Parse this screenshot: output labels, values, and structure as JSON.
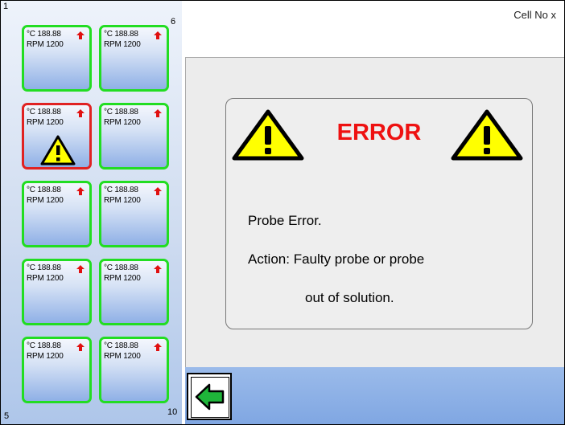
{
  "header": {
    "cell_no": "Cell No  x"
  },
  "corners": {
    "top_left": "1",
    "top_right": "6",
    "bottom_left": "5",
    "bottom_right": "10"
  },
  "cells": [
    {
      "temp": "°C 188.88",
      "rpm": "RPM 1200",
      "status": "ok",
      "warning": false
    },
    {
      "temp": "°C 188.88",
      "rpm": "RPM 1200",
      "status": "ok",
      "warning": false
    },
    {
      "temp": "°C 188.88",
      "rpm": "RPM 1200",
      "status": "error",
      "warning": true
    },
    {
      "temp": "°C 188.88",
      "rpm": "RPM 1200",
      "status": "ok",
      "warning": false
    },
    {
      "temp": "°C 188.88",
      "rpm": "RPM 1200",
      "status": "ok",
      "warning": false
    },
    {
      "temp": "°C 188.88",
      "rpm": "RPM 1200",
      "status": "ok",
      "warning": false
    },
    {
      "temp": "°C 188.88",
      "rpm": "RPM 1200",
      "status": "ok",
      "warning": false
    },
    {
      "temp": "°C 188.88",
      "rpm": "RPM 1200",
      "status": "ok",
      "warning": false
    },
    {
      "temp": "°C 188.88",
      "rpm": "RPM 1200",
      "status": "ok",
      "warning": false
    },
    {
      "temp": "°C 188.88",
      "rpm": "RPM 1200",
      "status": "ok",
      "warning": false
    }
  ],
  "error_panel": {
    "title": "ERROR",
    "line1": "Probe Error.",
    "line2": "Action: Faulty probe or probe",
    "line3": "out of solution."
  },
  "icons": {
    "cell_arrow": "arrow-up-icon",
    "cell_warning": "warning-icon",
    "back": "arrow-left-icon"
  },
  "colors": {
    "ok_border": "#22dd22",
    "error_border": "#e02222",
    "error_title": "#ee1111",
    "arrow": "#e01010",
    "back_arrow": "#1fb53a",
    "warning_fill": "#ffff00"
  }
}
